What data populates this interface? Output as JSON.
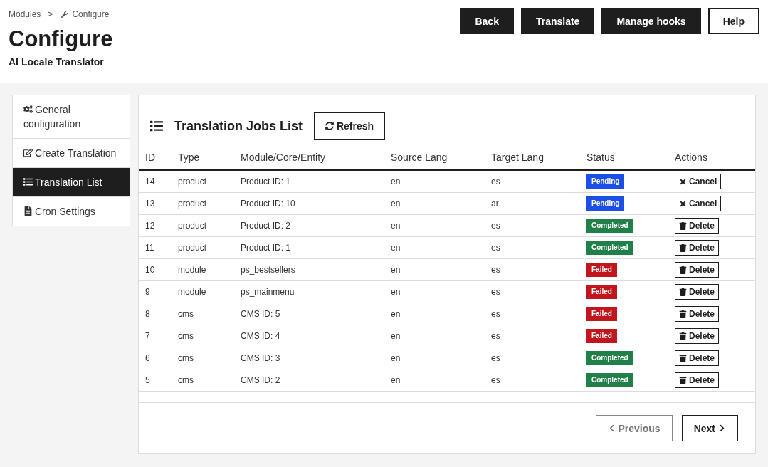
{
  "breadcrumb": {
    "parent": "Modules",
    "separator": ">",
    "current": "Configure"
  },
  "page": {
    "title": "Configure",
    "subtitle": "AI Locale Translator"
  },
  "header_buttons": [
    {
      "label": "Back",
      "kind": "dark"
    },
    {
      "label": "Translate",
      "kind": "dark"
    },
    {
      "label": "Manage hooks",
      "kind": "dark"
    },
    {
      "label": "Help",
      "kind": "light"
    }
  ],
  "sidebar": {
    "items": [
      {
        "label": "General configuration",
        "selected": false
      },
      {
        "label": "Create Translation",
        "selected": false
      },
      {
        "label": "Translation List",
        "selected": true
      },
      {
        "label": "Cron Settings",
        "selected": false
      }
    ]
  },
  "panel": {
    "title": "Translation Jobs List",
    "refresh_button": "Refresh"
  },
  "table": {
    "columns": [
      "ID",
      "Type",
      "Module/Core/Entity",
      "Source Lang",
      "Target Lang",
      "Status",
      "Actions"
    ],
    "rows": [
      {
        "id": "14",
        "type": "product",
        "entity": "Product ID: 1",
        "source": "en",
        "target": "es",
        "status": {
          "label": "Pending",
          "color": "#1b4fe6"
        },
        "action": {
          "kind": "cancel",
          "label": "Cancel"
        }
      },
      {
        "id": "13",
        "type": "product",
        "entity": "Product ID: 10",
        "source": "en",
        "target": "ar",
        "status": {
          "label": "Pending",
          "color": "#1b4fe6"
        },
        "action": {
          "kind": "cancel",
          "label": "Cancel"
        }
      },
      {
        "id": "12",
        "type": "product",
        "entity": "Product ID: 2",
        "source": "en",
        "target": "es",
        "status": {
          "label": "Completed",
          "color": "#21804a"
        },
        "action": {
          "kind": "delete",
          "label": "Delete"
        }
      },
      {
        "id": "11",
        "type": "product",
        "entity": "Product ID: 1",
        "source": "en",
        "target": "es",
        "status": {
          "label": "Completed",
          "color": "#21804a"
        },
        "action": {
          "kind": "delete",
          "label": "Delete"
        }
      },
      {
        "id": "10",
        "type": "module",
        "entity": "ps_bestsellers",
        "source": "en",
        "target": "es",
        "status": {
          "label": "Failed",
          "color": "#c2161e"
        },
        "action": {
          "kind": "delete",
          "label": "Delete"
        }
      },
      {
        "id": "9",
        "type": "module",
        "entity": "ps_mainmenu",
        "source": "en",
        "target": "es",
        "status": {
          "label": "Failed",
          "color": "#c2161e"
        },
        "action": {
          "kind": "delete",
          "label": "Delete"
        }
      },
      {
        "id": "8",
        "type": "cms",
        "entity": "CMS ID: 5",
        "source": "en",
        "target": "es",
        "status": {
          "label": "Failed",
          "color": "#c2161e"
        },
        "action": {
          "kind": "delete",
          "label": "Delete"
        }
      },
      {
        "id": "7",
        "type": "cms",
        "entity": "CMS ID: 4",
        "source": "en",
        "target": "es",
        "status": {
          "label": "Failed",
          "color": "#c2161e"
        },
        "action": {
          "kind": "delete",
          "label": "Delete"
        }
      },
      {
        "id": "6",
        "type": "cms",
        "entity": "CMS ID: 3",
        "source": "en",
        "target": "es",
        "status": {
          "label": "Completed",
          "color": "#21804a"
        },
        "action": {
          "kind": "delete",
          "label": "Delete"
        }
      },
      {
        "id": "5",
        "type": "cms",
        "entity": "CMS ID: 2",
        "source": "en",
        "target": "es",
        "status": {
          "label": "Completed",
          "color": "#21804a"
        },
        "action": {
          "kind": "delete",
          "label": "Delete"
        }
      }
    ]
  },
  "pagination": [
    {
      "label": "Previous",
      "kind": "previous",
      "disabled": true
    },
    {
      "label": "Next",
      "kind": "next",
      "disabled": false
    }
  ]
}
